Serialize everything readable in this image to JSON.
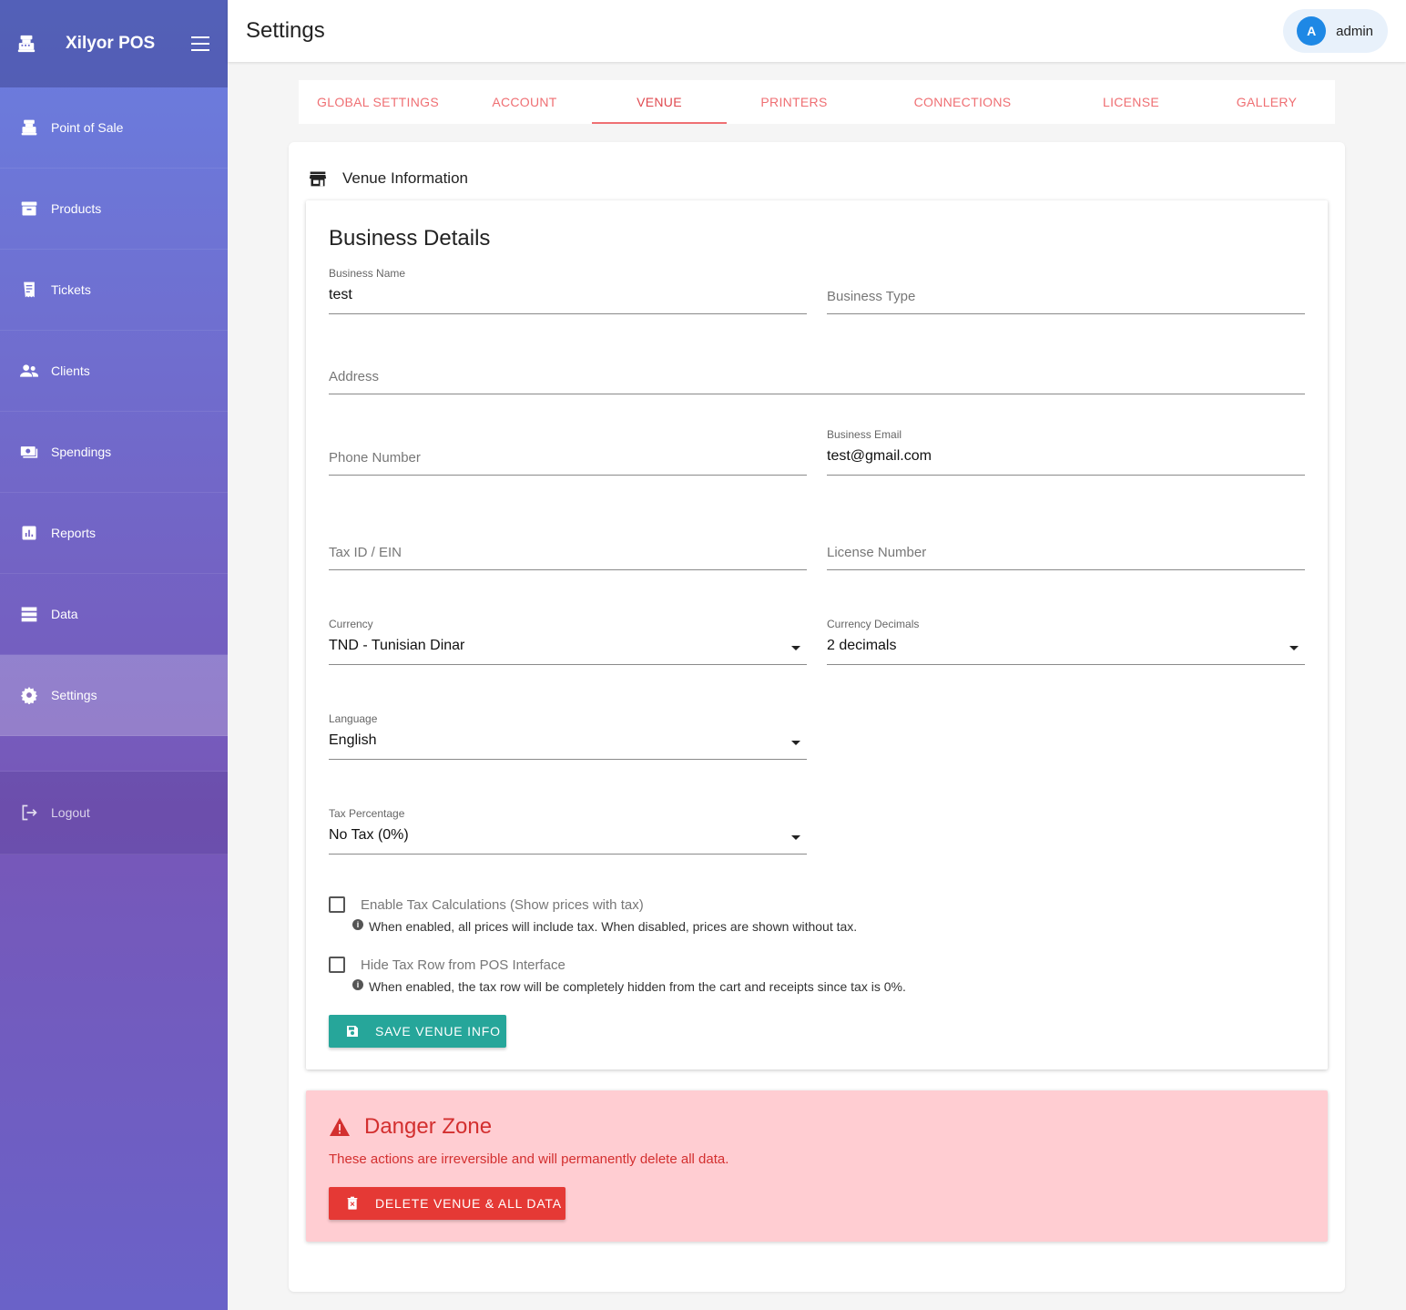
{
  "app": {
    "name": "Xilyor POS"
  },
  "sidebar": {
    "items": [
      {
        "label": "Point of Sale",
        "icon": "cash-register-icon"
      },
      {
        "label": "Products",
        "icon": "archive-box-icon"
      },
      {
        "label": "Tickets",
        "icon": "receipt-icon"
      },
      {
        "label": "Clients",
        "icon": "people-icon"
      },
      {
        "label": "Spendings",
        "icon": "money-icon"
      },
      {
        "label": "Reports",
        "icon": "bar-chart-icon"
      },
      {
        "label": "Data",
        "icon": "database-icon"
      },
      {
        "label": "Settings",
        "icon": "gear-icon",
        "active": true
      }
    ],
    "logout": {
      "label": "Logout",
      "icon": "logout-icon"
    }
  },
  "header": {
    "title": "Settings",
    "user": {
      "initial": "A",
      "name": "admin"
    }
  },
  "tabs": [
    {
      "label": "GLOBAL SETTINGS"
    },
    {
      "label": "ACCOUNT"
    },
    {
      "label": "VENUE",
      "active": true
    },
    {
      "label": "PRINTERS"
    },
    {
      "label": "CONNECTIONS"
    },
    {
      "label": "LICENSE"
    },
    {
      "label": "GALLERY"
    }
  ],
  "venue": {
    "section_title": "Venue Information",
    "details_title": "Business Details",
    "fields": {
      "business_name": {
        "label": "Business Name",
        "value": "test"
      },
      "business_type": {
        "placeholder": "Business Type"
      },
      "address": {
        "placeholder": "Address"
      },
      "phone": {
        "placeholder": "Phone Number"
      },
      "business_email": {
        "label": "Business Email",
        "value": "test@gmail.com"
      },
      "tax_id": {
        "placeholder": "Tax ID / EIN"
      },
      "license_number": {
        "placeholder": "License Number"
      },
      "currency": {
        "label": "Currency",
        "value": "TND - Tunisian Dinar"
      },
      "currency_decimals": {
        "label": "Currency Decimals",
        "value": "2 decimals"
      },
      "language": {
        "label": "Language",
        "value": "English"
      },
      "tax_percentage": {
        "label": "Tax Percentage",
        "value": "No Tax (0%)"
      }
    },
    "checkboxes": {
      "enable_tax": {
        "label": "Enable Tax Calculations (Show prices with tax)",
        "hint": "When enabled, all prices will include tax. When disabled, prices are shown without tax.",
        "checked": false
      },
      "hide_tax_row": {
        "label": "Hide Tax Row from POS Interface",
        "hint": "When enabled, the tax row will be completely hidden from the cart and receipts since tax is 0%.",
        "checked": false
      }
    },
    "save_label": "SAVE VENUE INFO"
  },
  "danger": {
    "title": "Danger Zone",
    "text": "These actions are irreversible and will permanently delete all data.",
    "delete_label": "DELETE VENUE & ALL DATA"
  },
  "colors": {
    "accent_tab": "#ef6f73",
    "save_button": "#26a69a",
    "danger_bg": "#ffcdd2",
    "danger_text": "#d32f2f",
    "delete_button": "#e53935",
    "avatar": "#1e88e5"
  }
}
